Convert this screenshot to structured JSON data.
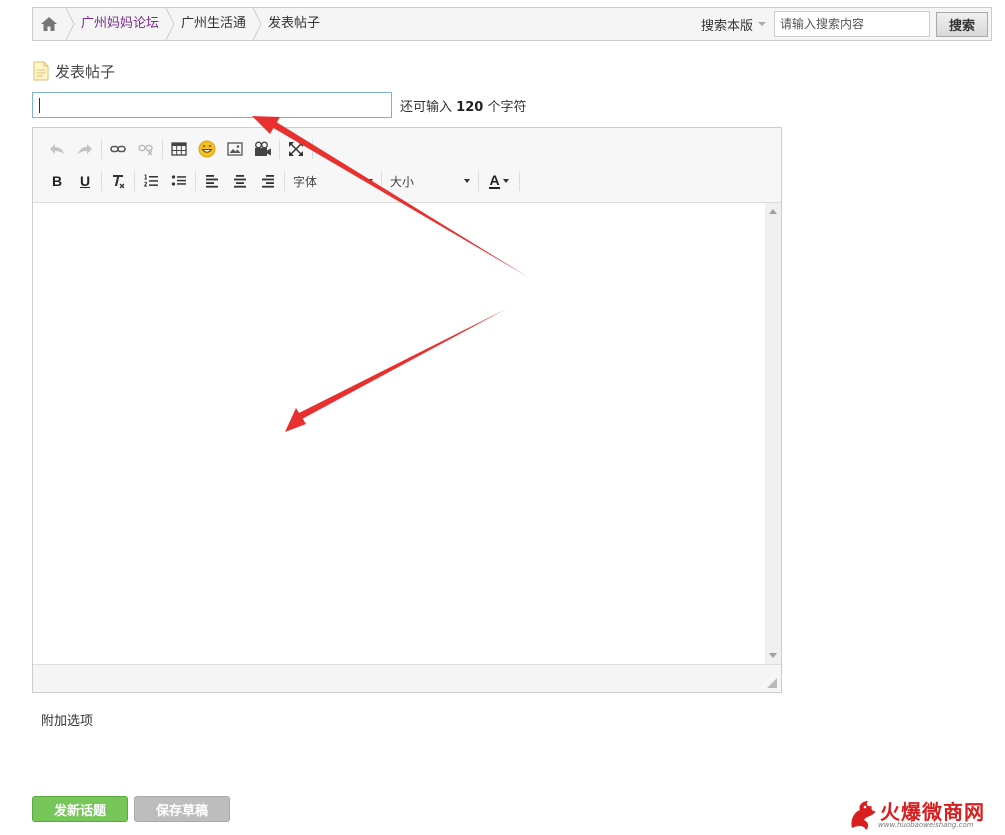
{
  "breadcrumb": {
    "items": [
      "广州妈妈论坛",
      "广州生活通",
      "发表帖子"
    ]
  },
  "search": {
    "scope_label": "搜索本版",
    "placeholder": "请输入搜索内容",
    "button_label": "搜索"
  },
  "page": {
    "title": "发表帖子"
  },
  "subject": {
    "value": "",
    "hint_prefix": "还可输入",
    "remaining": "120",
    "hint_suffix": "个字符"
  },
  "editor": {
    "font_select": "字体",
    "size_select": "大小",
    "bold_label": "B",
    "underline_label": "U",
    "color_label": "A",
    "toolbar_row1_icons": [
      "undo-icon",
      "redo-icon",
      "link-icon",
      "unlink-icon",
      "table-icon",
      "emoji-icon",
      "image-icon",
      "video-icon",
      "fullscreen-icon"
    ],
    "toolbar_row2_icons": [
      "bold-icon",
      "underline-icon",
      "clear-format-icon",
      "ordered-list-icon",
      "unordered-list-icon",
      "align-left-icon",
      "align-center-icon",
      "align-right-icon",
      "font-color-icon"
    ]
  },
  "extra_options": {
    "label": "附加选项"
  },
  "actions": {
    "post_label": "发新话题",
    "draft_label": "保存草稿"
  },
  "watermark": {
    "brand": "火爆微商网",
    "url": "www.huobaoweishang.com"
  },
  "colors": {
    "link": "#7a2e8c",
    "post_button": "#77c65a",
    "draft_button": "#bdbdbd",
    "annotation_arrow": "#e8302e"
  }
}
